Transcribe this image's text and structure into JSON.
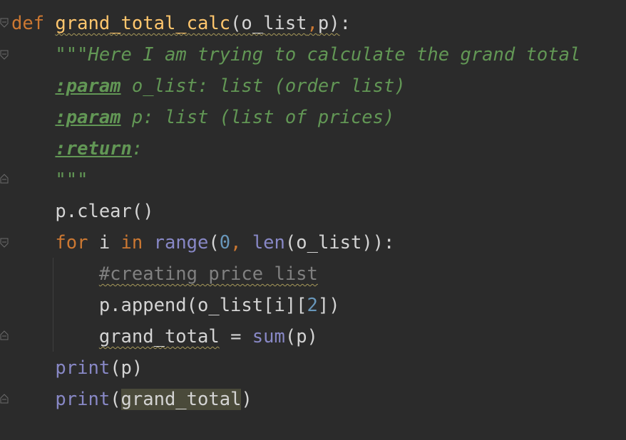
{
  "editor": {
    "lines": [
      {
        "id": "l1",
        "parts": [
          {
            "t": "def",
            "c": "kw"
          },
          {
            "t": " ",
            "c": "plain"
          },
          {
            "t": "grand_total_calc",
            "c": "fn squiggle"
          },
          {
            "t": "(o_list",
            "c": "plain squiggle"
          },
          {
            "t": ",",
            "c": "kw squiggle"
          },
          {
            "t": "p)",
            "c": "plain squiggle"
          },
          {
            "t": ":",
            "c": "plain"
          }
        ]
      },
      {
        "id": "l2",
        "parts": [
          {
            "t": "    ",
            "c": "plain"
          },
          {
            "t": "\"\"\"Here I am trying to calculate the grand total",
            "c": "doc"
          }
        ]
      },
      {
        "id": "l3",
        "parts": [
          {
            "t": "    ",
            "c": "plain"
          },
          {
            "t": ":param",
            "c": "doctag"
          },
          {
            "t": " o_list: list (order list)",
            "c": "doc"
          }
        ]
      },
      {
        "id": "l4",
        "parts": [
          {
            "t": "    ",
            "c": "plain"
          },
          {
            "t": ":param",
            "c": "doctag"
          },
          {
            "t": " p: list (list of prices)",
            "c": "doc"
          }
        ]
      },
      {
        "id": "l5",
        "parts": [
          {
            "t": "    ",
            "c": "plain"
          },
          {
            "t": ":return",
            "c": "doctag"
          },
          {
            "t": ":",
            "c": "doc"
          }
        ]
      },
      {
        "id": "l6",
        "parts": [
          {
            "t": "    ",
            "c": "plain"
          },
          {
            "t": "\"\"\"",
            "c": "doc"
          }
        ]
      },
      {
        "id": "l7",
        "parts": [
          {
            "t": "    p.clear()",
            "c": "plain"
          }
        ]
      },
      {
        "id": "l8",
        "parts": [
          {
            "t": "    ",
            "c": "plain"
          },
          {
            "t": "for",
            "c": "kw"
          },
          {
            "t": " i ",
            "c": "plain"
          },
          {
            "t": "in",
            "c": "kw"
          },
          {
            "t": " ",
            "c": "plain"
          },
          {
            "t": "range",
            "c": "builtin"
          },
          {
            "t": "(",
            "c": "plain"
          },
          {
            "t": "0",
            "c": "num"
          },
          {
            "t": ",",
            "c": "kw"
          },
          {
            "t": " ",
            "c": "plain"
          },
          {
            "t": "len",
            "c": "builtin"
          },
          {
            "t": "(o_list)):",
            "c": "plain"
          }
        ]
      },
      {
        "id": "l9",
        "parts": [
          {
            "t": "        ",
            "c": "plain"
          },
          {
            "t": "#creating price list",
            "c": "cmt squiggle"
          }
        ]
      },
      {
        "id": "l10",
        "parts": [
          {
            "t": "        p.append(o_list[i][",
            "c": "plain"
          },
          {
            "t": "2",
            "c": "num"
          },
          {
            "t": "])",
            "c": "plain"
          }
        ]
      },
      {
        "id": "l11",
        "parts": [
          {
            "t": "        ",
            "c": "plain"
          },
          {
            "t": "grand_total",
            "c": "plain squiggle"
          },
          {
            "t": " = ",
            "c": "plain"
          },
          {
            "t": "sum",
            "c": "builtin"
          },
          {
            "t": "(p)",
            "c": "plain"
          }
        ]
      },
      {
        "id": "l12",
        "parts": [
          {
            "t": "    ",
            "c": "plain"
          },
          {
            "t": "print",
            "c": "builtin"
          },
          {
            "t": "(p)",
            "c": "plain"
          }
        ]
      },
      {
        "id": "l13",
        "parts": [
          {
            "t": "    ",
            "c": "plain"
          },
          {
            "t": "print",
            "c": "builtin"
          },
          {
            "t": "(",
            "c": "plain"
          },
          {
            "t": "grand_total",
            "c": "plain highlight"
          },
          {
            "t": ")",
            "c": "plain"
          }
        ]
      }
    ],
    "fold_markers": [
      {
        "name": "fold-open-icon"
      },
      {
        "name": "fold-open-icon"
      },
      {
        "name": "fold-close-icon"
      },
      {
        "name": "fold-open-icon"
      },
      {
        "name": "fold-close-icon"
      },
      {
        "name": "fold-close-icon"
      }
    ]
  }
}
